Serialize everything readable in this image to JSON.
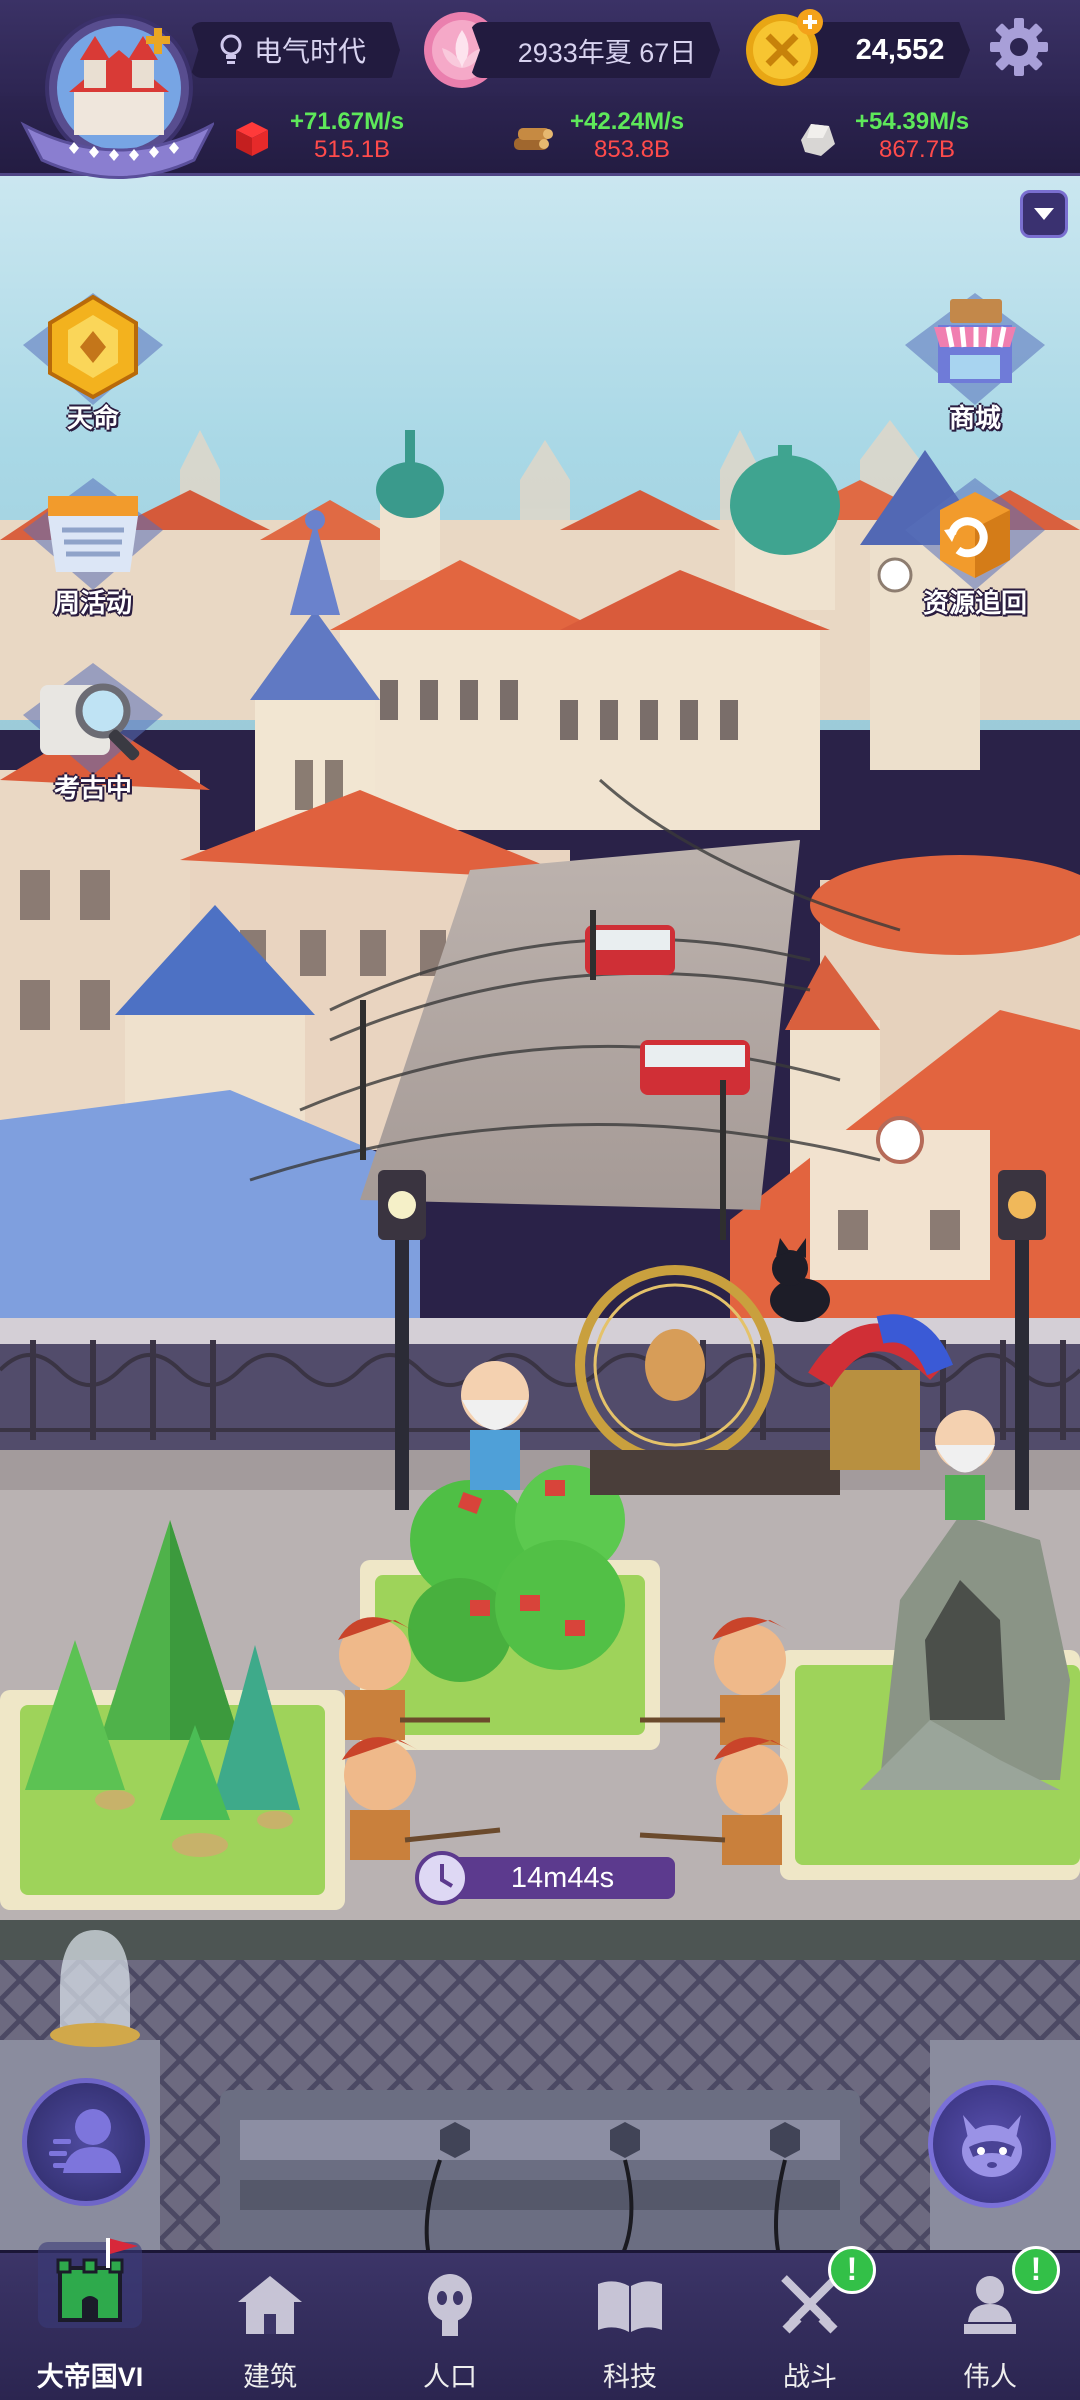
{
  "header": {
    "era": "电气时代",
    "date": "2933年夏 67日",
    "coins": "24,552"
  },
  "resources": [
    {
      "name": "red-block-resource",
      "rate": "+71.67M/s",
      "amount": "515.1B"
    },
    {
      "name": "wood-resource",
      "rate": "+42.24M/s",
      "amount": "853.8B"
    },
    {
      "name": "stone-resource",
      "rate": "+54.39M/s",
      "amount": "867.7B"
    }
  ],
  "side_buttons": {
    "destiny": "天命",
    "shop": "商城",
    "weekly_event": "周活动",
    "resource_recall": "资源追回",
    "archaeology": "考古中"
  },
  "timer": "14m44s",
  "nav": [
    {
      "label": "大帝国VI",
      "active": true,
      "alert": false
    },
    {
      "label": "建筑",
      "active": false,
      "alert": false
    },
    {
      "label": "人口",
      "active": false,
      "alert": false
    },
    {
      "label": "科技",
      "active": false,
      "alert": false
    },
    {
      "label": "战斗",
      "active": false,
      "alert": true
    },
    {
      "label": "伟人",
      "active": false,
      "alert": true
    }
  ],
  "colors": {
    "rate_green": "#5ee85a",
    "amount_red": "#ff4b4b",
    "bar_purple": "#2d2552",
    "timer_purple": "#5c3a8e",
    "alert_green": "#33c048"
  }
}
